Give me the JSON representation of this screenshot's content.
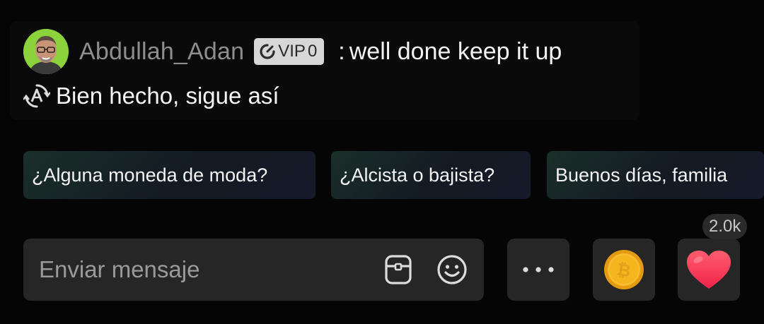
{
  "message": {
    "username": "Abdullah_Adan",
    "badge": {
      "label": "VIP",
      "level": "0"
    },
    "separator": ":",
    "text": "well done keep it up",
    "translation": "Bien hecho, sigue así"
  },
  "suggestions": [
    {
      "label": "¿Alguna moneda de moda?"
    },
    {
      "label": "¿Alcista o bajista?"
    },
    {
      "label": "Buenos días, familia"
    }
  ],
  "composer": {
    "placeholder": "Enviar mensaje"
  },
  "reactions": {
    "like_count": "2.0k"
  },
  "icons": {
    "avatar": "avatar",
    "badge": "vip-gauge-icon",
    "translate": "translate-icon",
    "gift": "gift-box-icon",
    "emoji": "emoji-icon",
    "more": "more-dots-icon",
    "coin": "bitcoin-coin-icon",
    "heart": "heart-icon"
  },
  "colors": {
    "background": "#050505",
    "avatar_bg": "#8bd23d",
    "heart": "#ff3b57",
    "coin": "#f5b51e"
  }
}
